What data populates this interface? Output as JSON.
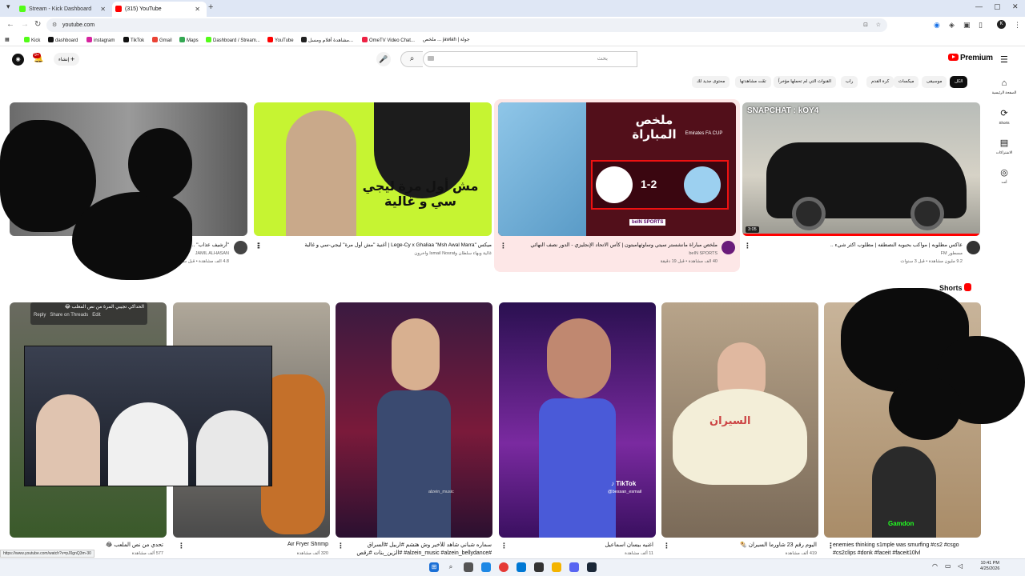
{
  "browser": {
    "tabs": [
      {
        "label": "Stream - Kick Dashboard"
      },
      {
        "label": "(315) YouTube"
      }
    ],
    "url": "youtube.com",
    "bookmarks": [
      "Kick",
      "dashboard",
      "instagram",
      "TikTok",
      "Gmail",
      "Maps",
      "Dashboard / Stream...",
      "YouTube",
      "مشاهدة أفلام ومسل...",
      "OmeTV Video Chat...",
      "ملخص ... jawlah | جولة"
    ],
    "status_url": "https://www.youtube.com/watch?v=pJ0gnQ3m-30"
  },
  "youtube": {
    "logo": "Premium",
    "search_placeholder": "بحث",
    "create_label": "إنشاء",
    "notifications": "9+",
    "chips": [
      "الكل",
      "موسيقى",
      "ميكسات",
      "كرة القدم",
      "راب",
      "القنوات التي لم تحملها مؤخراً",
      "تمّت مشاهدتها",
      "محتوى جديد لك"
    ],
    "side_nav": [
      {
        "label": "الصفحة الرئيسية"
      },
      {
        "label": "Shorts"
      },
      {
        "label": "الاشتراكات"
      },
      {
        "label": "أنت"
      }
    ],
    "videos": [
      {
        "title": "عاكس مطلوبه | مواكب بحبوبه النصطفه | مطلوب اكثر شيء ..",
        "channel": "مسطور FM",
        "meta": "9.2 مليون مشاهدة • قبل 3 سنوات",
        "duration": "3:05",
        "thumb_text": "SNAPCHAT : kOY4"
      },
      {
        "title": "ملخص مباراة مانشستر سيتي وساوثهامبتون | كأس الاتحاد الإنجليزي - الدور نصف النهائي",
        "channel": "beIN SPORTS",
        "meta": "40 ألف مشاهدة • قبل 19 دقيقة",
        "thumb_text": "ملخص المباراة",
        "score": "1-2",
        "cup": "Emirates FA CUP"
      },
      {
        "title": "ميكس \"Lege-Cy x Ghaliaa \"Msh Awal Marra | أغنية \"مش أول مرة\" ليجي-سي و غالية",
        "channel": "غالية وبهاء سلطان وIsmail Nosrat وآخرون",
        "meta": "",
        "thumb_text": "مش أول مرة ليجي سي و غالية"
      },
      {
        "title": "\"أرشيف عذاب\" ...",
        "channel": "JAMIL ALHASAN",
        "meta": "4.8 ألف مشاهدة • قبل ساعات",
        "thumb_text": ""
      }
    ],
    "shorts_header": "Shorts",
    "shorts": [
      {
        "title": "enemies thinking s1mple was smurfing #cs2 #csgo #cs2clips #donk #faceit #faceit10lvl",
        "meta": "",
        "thumb_text": "Gamdon"
      },
      {
        "title": "اليوم رقم 23 شاورما السيران 🌯",
        "meta": "419 ألف مشاهدة",
        "thumb_text": "السيران"
      },
      {
        "title": "اغنيه بيسان اسماعيل",
        "meta": "11 ألف مشاهدة",
        "thumb_text": "@bessan_esmail"
      },
      {
        "title": "سماره شباني شاهد للأخير وش هتشم #اربيل #السراق #alzein_music #alzein_bellydance# #الزين_بنات #رقص",
        "meta": "",
        "thumb_text": "alzein_music"
      },
      {
        "title": "Air Fryer Shrimp",
        "meta": "320 ألف مشاهدة",
        "thumb_text": ""
      },
      {
        "title": "تحدي من نص الملعب 😂",
        "meta": "577 ألف مشاهدة",
        "thumb_text": ""
      }
    ]
  },
  "overlay": {
    "comment_text": "الحداكي تجيبي المرة من نص المعلب 😂",
    "comment_actions": [
      "Reply",
      "Share on Threads",
      "Edit"
    ]
  },
  "taskbar": {
    "time": "10:41 PM",
    "date": "4/25/2026"
  }
}
